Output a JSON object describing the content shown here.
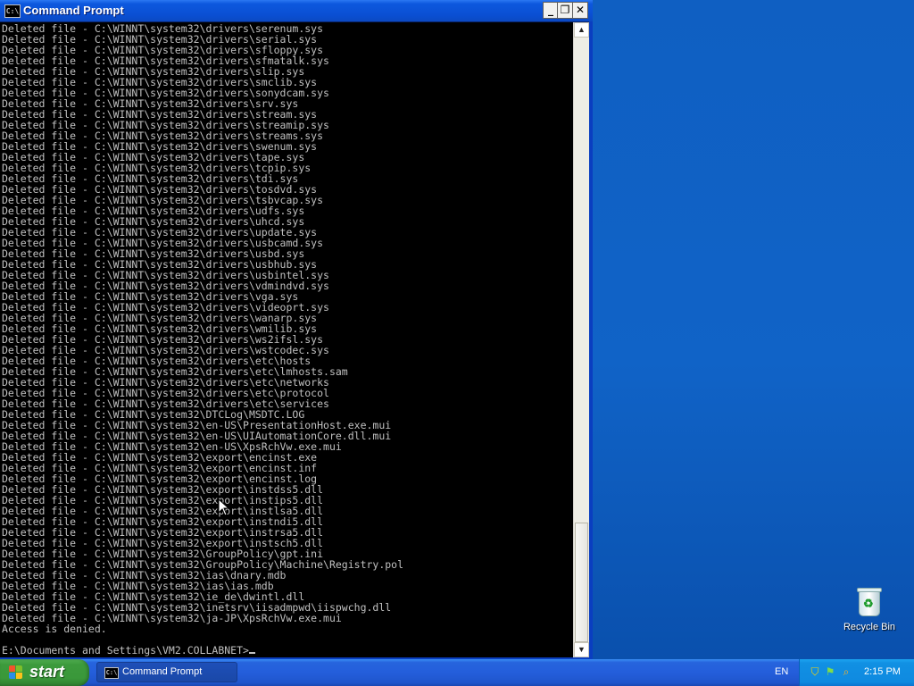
{
  "window": {
    "title": "Command Prompt",
    "icon_text": "C:\\",
    "controls": {
      "minimize": "_",
      "maximize": "❐",
      "close": "✕"
    }
  },
  "console": {
    "lines": [
      "Deleted file - C:\\WINNT\\system32\\drivers\\serenum.sys",
      "Deleted file - C:\\WINNT\\system32\\drivers\\serial.sys",
      "Deleted file - C:\\WINNT\\system32\\drivers\\sfloppy.sys",
      "Deleted file - C:\\WINNT\\system32\\drivers\\sfmatalk.sys",
      "Deleted file - C:\\WINNT\\system32\\drivers\\slip.sys",
      "Deleted file - C:\\WINNT\\system32\\drivers\\smclib.sys",
      "Deleted file - C:\\WINNT\\system32\\drivers\\sonydcam.sys",
      "Deleted file - C:\\WINNT\\system32\\drivers\\srv.sys",
      "Deleted file - C:\\WINNT\\system32\\drivers\\stream.sys",
      "Deleted file - C:\\WINNT\\system32\\drivers\\streamip.sys",
      "Deleted file - C:\\WINNT\\system32\\drivers\\streams.sys",
      "Deleted file - C:\\WINNT\\system32\\drivers\\swenum.sys",
      "Deleted file - C:\\WINNT\\system32\\drivers\\tape.sys",
      "Deleted file - C:\\WINNT\\system32\\drivers\\tcpip.sys",
      "Deleted file - C:\\WINNT\\system32\\drivers\\tdi.sys",
      "Deleted file - C:\\WINNT\\system32\\drivers\\tosdvd.sys",
      "Deleted file - C:\\WINNT\\system32\\drivers\\tsbvcap.sys",
      "Deleted file - C:\\WINNT\\system32\\drivers\\udfs.sys",
      "Deleted file - C:\\WINNT\\system32\\drivers\\uhcd.sys",
      "Deleted file - C:\\WINNT\\system32\\drivers\\update.sys",
      "Deleted file - C:\\WINNT\\system32\\drivers\\usbcamd.sys",
      "Deleted file - C:\\WINNT\\system32\\drivers\\usbd.sys",
      "Deleted file - C:\\WINNT\\system32\\drivers\\usbhub.sys",
      "Deleted file - C:\\WINNT\\system32\\drivers\\usbintel.sys",
      "Deleted file - C:\\WINNT\\system32\\drivers\\vdmindvd.sys",
      "Deleted file - C:\\WINNT\\system32\\drivers\\vga.sys",
      "Deleted file - C:\\WINNT\\system32\\drivers\\videoprt.sys",
      "Deleted file - C:\\WINNT\\system32\\drivers\\wanarp.sys",
      "Deleted file - C:\\WINNT\\system32\\drivers\\wmilib.sys",
      "Deleted file - C:\\WINNT\\system32\\drivers\\ws2ifsl.sys",
      "Deleted file - C:\\WINNT\\system32\\drivers\\wstcodec.sys",
      "Deleted file - C:\\WINNT\\system32\\drivers\\etc\\hosts",
      "Deleted file - C:\\WINNT\\system32\\drivers\\etc\\lmhosts.sam",
      "Deleted file - C:\\WINNT\\system32\\drivers\\etc\\networks",
      "Deleted file - C:\\WINNT\\system32\\drivers\\etc\\protocol",
      "Deleted file - C:\\WINNT\\system32\\drivers\\etc\\services",
      "Deleted file - C:\\WINNT\\system32\\DTCLog\\MSDTC.LOG",
      "Deleted file - C:\\WINNT\\system32\\en-US\\PresentationHost.exe.mui",
      "Deleted file - C:\\WINNT\\system32\\en-US\\UIAutomationCore.dll.mui",
      "Deleted file - C:\\WINNT\\system32\\en-US\\XpsRchVw.exe.mui",
      "Deleted file - C:\\WINNT\\system32\\export\\encinst.exe",
      "Deleted file - C:\\WINNT\\system32\\export\\encinst.inf",
      "Deleted file - C:\\WINNT\\system32\\export\\encinst.log",
      "Deleted file - C:\\WINNT\\system32\\export\\instdss5.dll",
      "Deleted file - C:\\WINNT\\system32\\export\\instips5.dll",
      "Deleted file - C:\\WINNT\\system32\\export\\instlsa5.dll",
      "Deleted file - C:\\WINNT\\system32\\export\\instndi5.dll",
      "Deleted file - C:\\WINNT\\system32\\export\\instrsa5.dll",
      "Deleted file - C:\\WINNT\\system32\\export\\instsch5.dll",
      "Deleted file - C:\\WINNT\\system32\\GroupPolicy\\gpt.ini",
      "Deleted file - C:\\WINNT\\system32\\GroupPolicy\\Machine\\Registry.pol",
      "Deleted file - C:\\WINNT\\system32\\ias\\dnary.mdb",
      "Deleted file - C:\\WINNT\\system32\\ias\\ias.mdb",
      "Deleted file - C:\\WINNT\\system32\\ie_de\\dwintl.dll",
      "Deleted file - C:\\WINNT\\system32\\inetsrv\\iisadmpwd\\iispwchg.dll",
      "Deleted file - C:\\WINNT\\system32\\ja-JP\\XpsRchVw.exe.mui",
      "Access is denied.",
      ""
    ],
    "prompt": "E:\\Documents and Settings\\VM2.COLLABNET>"
  },
  "scrollbar": {
    "up_arrow": "▲",
    "down_arrow": "▼"
  },
  "desktop": {
    "recycle_bin_label": "Recycle Bin",
    "recycle_bin_icon": "recycle-bin-icon"
  },
  "taskbar": {
    "start_label": "start",
    "task_button_label": "Command Prompt",
    "language": "EN",
    "clock": "2:15 PM"
  },
  "colors": {
    "console_bg": "#000000",
    "console_text": "#c0c0c0",
    "titlebar": "#0a4fd3",
    "taskbar": "#245edb",
    "start_button": "#3c9a3c",
    "desktop": "#0f5fc2"
  }
}
